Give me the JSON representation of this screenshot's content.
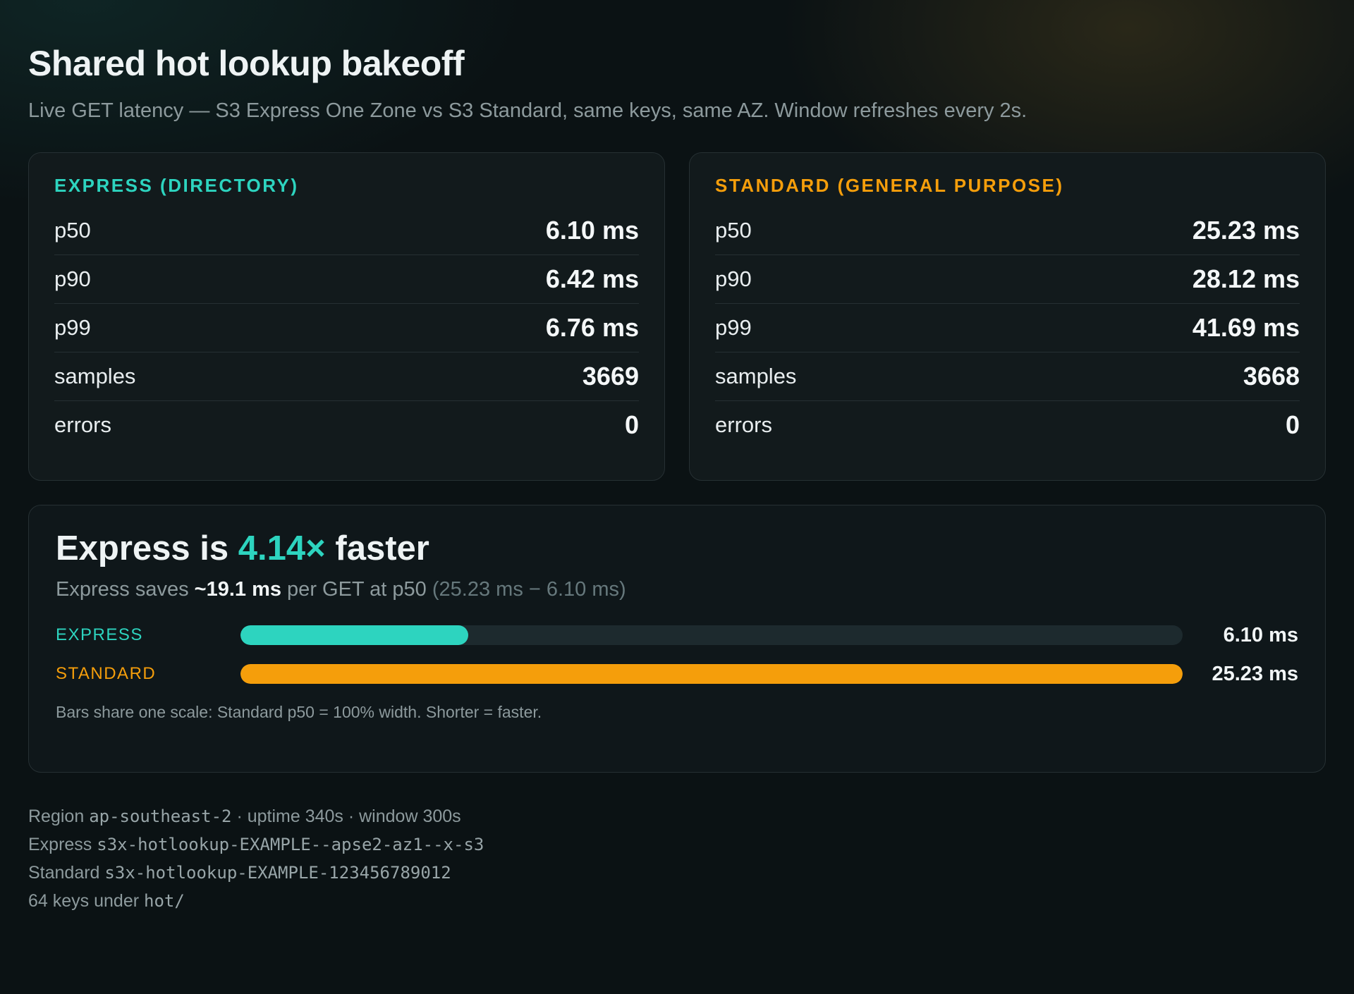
{
  "header": {
    "title": "Shared hot lookup bakeoff",
    "subtitle": "Live GET latency — S3 Express One Zone vs S3 Standard, same keys, same AZ. Window refreshes every 2s."
  },
  "colors": {
    "express": "#2dd4bf",
    "standard": "#f59e0b"
  },
  "express_card": {
    "title": "EXPRESS (DIRECTORY)",
    "rows": [
      {
        "label": "p50",
        "value": "6.10 ms"
      },
      {
        "label": "p90",
        "value": "6.42 ms"
      },
      {
        "label": "p99",
        "value": "6.76 ms"
      },
      {
        "label": "samples",
        "value": "3669"
      },
      {
        "label": "errors",
        "value": "0"
      }
    ]
  },
  "standard_card": {
    "title": "STANDARD (GENERAL PURPOSE)",
    "rows": [
      {
        "label": "p50",
        "value": "25.23 ms"
      },
      {
        "label": "p90",
        "value": "28.12 ms"
      },
      {
        "label": "p99",
        "value": "41.69 ms"
      },
      {
        "label": "samples",
        "value": "3668"
      },
      {
        "label": "errors",
        "value": "0"
      }
    ]
  },
  "summary": {
    "headline_prefix": "Express is ",
    "factor": "4.14×",
    "headline_suffix": " faster",
    "saves_prefix": "Express saves ",
    "saves_amount": "~19.1 ms",
    "saves_middle": " per GET at p50 ",
    "saves_calc": "(25.23 ms − 6.10 ms)",
    "bars": [
      {
        "label": "EXPRESS",
        "value": "6.10 ms",
        "fraction": 0.2418
      },
      {
        "label": "STANDARD",
        "value": "25.23 ms",
        "fraction": 1.0
      }
    ],
    "note": "Bars share one scale: Standard p50 = 100% width. Shorter = faster."
  },
  "footer": {
    "region_label": "Region",
    "region": "ap-southeast-2",
    "region_suffix": "· uptime 340s · window 300s",
    "express_label": "Express",
    "express_bucket": "s3x-hotlookup-EXAMPLE--apse2-az1--x-s3",
    "standard_label": "Standard",
    "standard_bucket": "s3x-hotlookup-EXAMPLE-123456789012",
    "keys_text": "64 keys under",
    "keys_prefix": "hot/"
  }
}
